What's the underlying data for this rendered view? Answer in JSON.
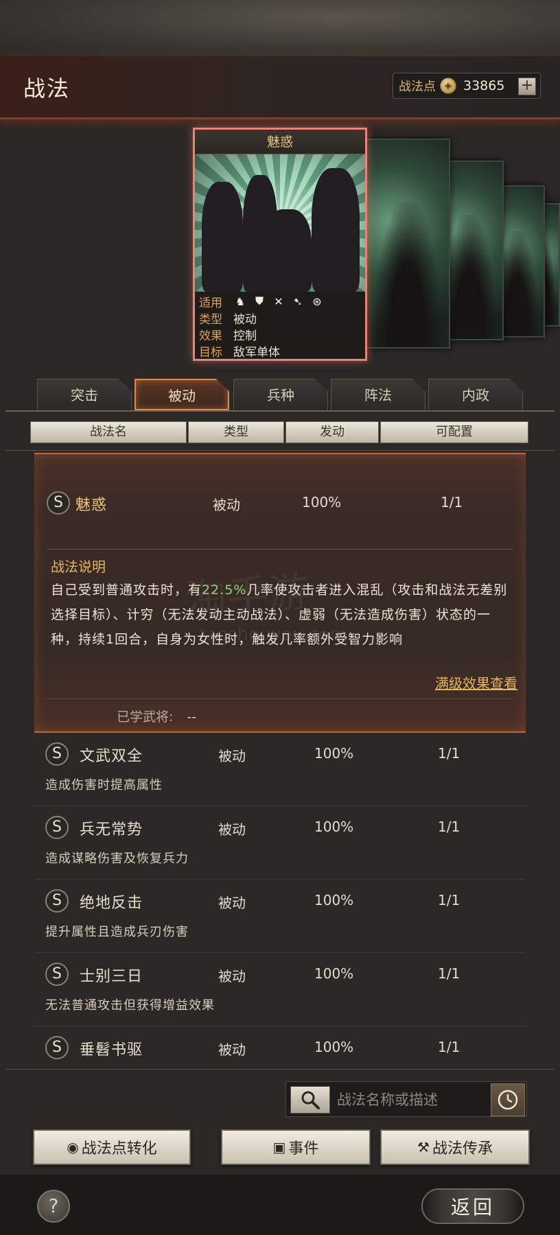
{
  "header": {
    "title": "战法",
    "points_label": "战法点",
    "points_value": "33865",
    "plus_label": "+"
  },
  "card": {
    "name": "魅惑",
    "rows": [
      {
        "label": "适用",
        "value": ""
      },
      {
        "label": "类型",
        "value": "被动"
      },
      {
        "label": "效果",
        "value": "控制"
      },
      {
        "label": "目标",
        "value": "敌军单体"
      }
    ],
    "unit_icons": [
      "cavalry-icon",
      "shield-icon",
      "bow-icon",
      "spear-icon",
      "wheel-icon"
    ]
  },
  "tabs": [
    {
      "label": "突击",
      "active": false
    },
    {
      "label": "被动",
      "active": true
    },
    {
      "label": "兵种",
      "active": false
    },
    {
      "label": "阵法",
      "active": false
    },
    {
      "label": "内政",
      "active": false
    }
  ],
  "columns": [
    "战法名",
    "类型",
    "发动",
    "可配置"
  ],
  "expanded": {
    "grade": "S",
    "name": "魅惑",
    "type": "被动",
    "activation": "100%",
    "config": "1/1",
    "desc_title": "战法说明",
    "desc_part1": "自己受到普通攻击时，有",
    "desc_pct": "22.5%",
    "desc_part2": "几率使攻击者进入混乱（攻击和战法无差别选择目标）、计穷（无法发动主动战法）、虚弱（无法造成伤害）状态的一种，持续1回合，自身为女性时，触发几率额外受智力影响",
    "full_effect_link": "满级效果查看",
    "learned_label": "已学武将:",
    "learned_value": "--"
  },
  "rows": [
    {
      "grade": "S",
      "name": "文武双全",
      "type": "被动",
      "activation": "100%",
      "config": "1/1",
      "desc": "造成伤害时提高属性"
    },
    {
      "grade": "S",
      "name": "兵无常势",
      "type": "被动",
      "activation": "100%",
      "config": "1/1",
      "desc": "造成谋略伤害及恢复兵力"
    },
    {
      "grade": "S",
      "name": "绝地反击",
      "type": "被动",
      "activation": "100%",
      "config": "1/1",
      "desc": "提升属性且造成兵刃伤害"
    },
    {
      "grade": "S",
      "name": "士别三日",
      "type": "被动",
      "activation": "100%",
      "config": "1/1",
      "desc": "无法普通攻击但获得增益效果"
    },
    {
      "grade": "S",
      "name": "垂髫书驱",
      "type": "被动",
      "activation": "100%",
      "config": "1/1",
      "desc": ""
    }
  ],
  "search": {
    "placeholder": "战法名称或描述"
  },
  "buttons": {
    "convert": "战法点转化",
    "event": "事件",
    "inherit": "战法传承",
    "help": "?",
    "back": "返回"
  },
  "watermark": {
    "main": "淘手游",
    "sub": "taoshouyou.com"
  },
  "colors": {
    "accent": "#e6b45a",
    "highlight_pct": "#8fd37a",
    "active_tab_border": "#e08a48",
    "card_border": "#e9837a"
  }
}
